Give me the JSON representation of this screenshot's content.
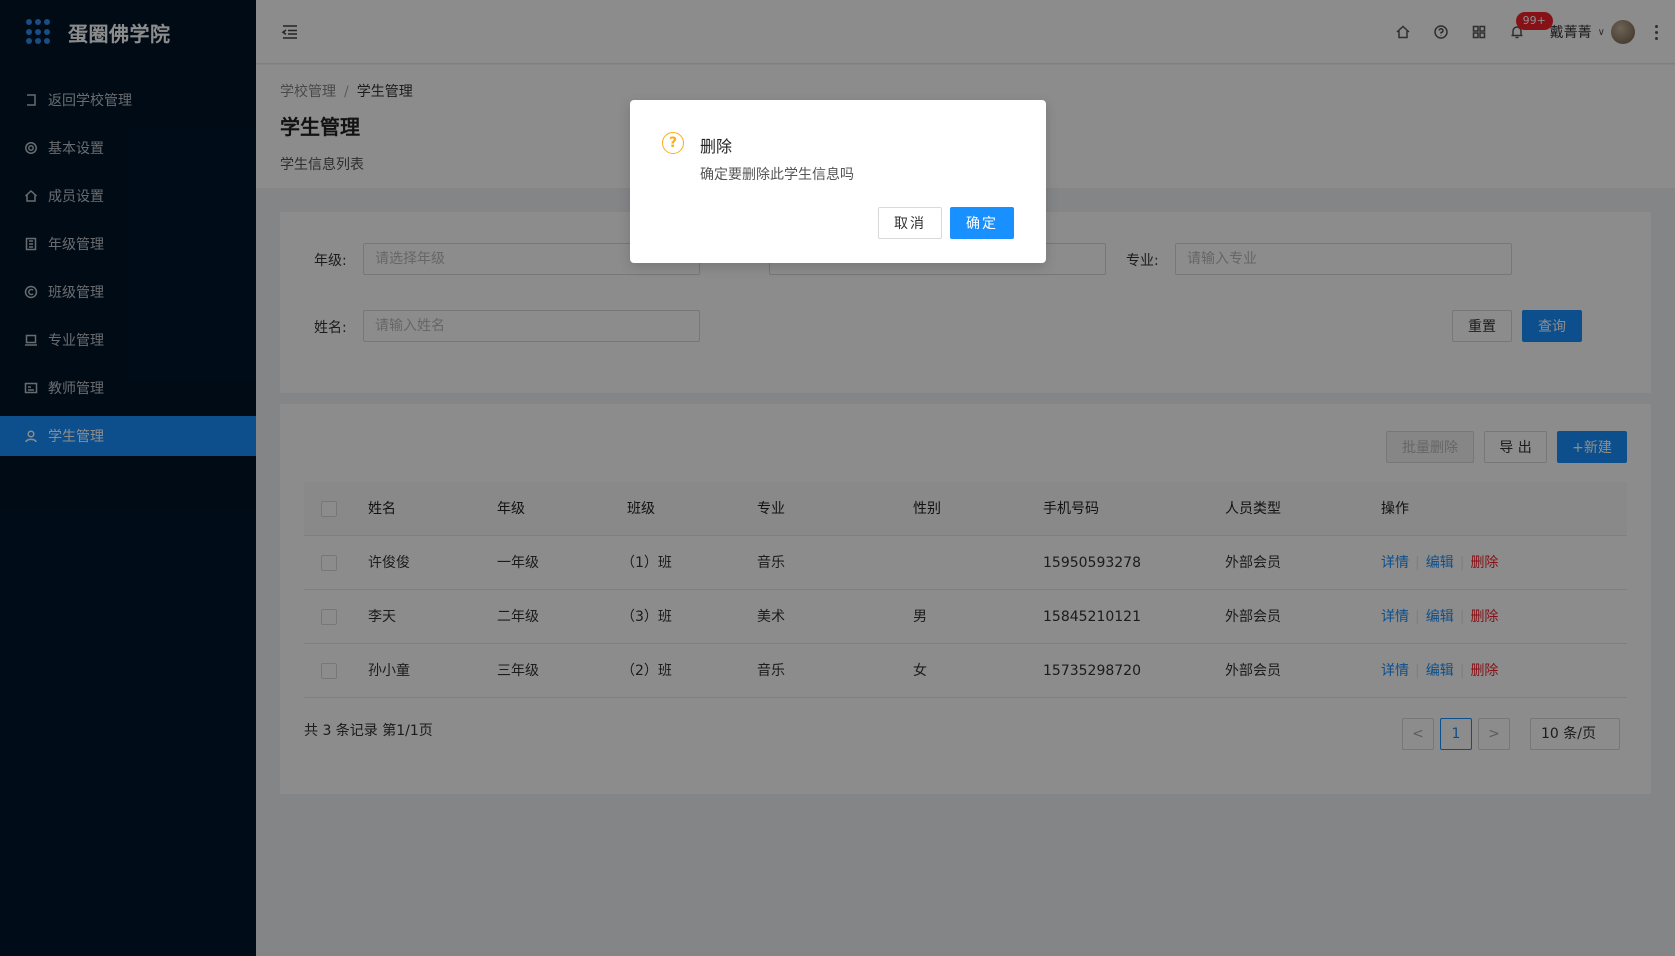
{
  "app": {
    "title": "蛋圈佛学院"
  },
  "sidebar": {
    "items": [
      {
        "label": "返回学校管理",
        "icon": "back-icon"
      },
      {
        "label": "基本设置",
        "icon": "gear-icon"
      },
      {
        "label": "成员设置",
        "icon": "home-icon"
      },
      {
        "label": "年级管理",
        "icon": "building-icon"
      },
      {
        "label": "班级管理",
        "icon": "copyright-icon"
      },
      {
        "label": "专业管理",
        "icon": "laptop-icon"
      },
      {
        "label": "教师管理",
        "icon": "idcard-icon"
      },
      {
        "label": "学生管理",
        "icon": "user-icon",
        "active": true
      }
    ]
  },
  "header": {
    "badge": "99+",
    "user_name": "戴菁菁",
    "caret": "∨"
  },
  "page": {
    "breadcrumb": [
      "学校管理",
      "学生管理"
    ],
    "breadcrumb_sep": "/",
    "title": "学生管理",
    "description": "学生信息列表"
  },
  "filters": {
    "grade_label": "年级:",
    "grade_placeholder": "请选择年级",
    "major_label": "专业:",
    "major_placeholder": "请输入专业",
    "name_label": "姓名:",
    "name_placeholder": "请输入姓名",
    "reset_label": "重置",
    "search_label": "查询"
  },
  "toolbar": {
    "batch_delete_label": "批量删除",
    "export_label": "导 出",
    "new_label": "+新建"
  },
  "table": {
    "columns": [
      "姓名",
      "年级",
      "班级",
      "专业",
      "性别",
      "手机号码",
      "人员类型",
      "操作"
    ],
    "rows": [
      {
        "name": "许俊俊",
        "grade": "一年级",
        "class": "（1）班",
        "major": "音乐",
        "gender": "",
        "phone": "15950593278",
        "type": "外部会员"
      },
      {
        "name": "李天",
        "grade": "二年级",
        "class": "（3）班",
        "major": "美术",
        "gender": "男",
        "phone": "15845210121",
        "type": "外部会员"
      },
      {
        "name": "孙小童",
        "grade": "三年级",
        "class": "（2）班",
        "major": "音乐",
        "gender": "女",
        "phone": "15735298720",
        "type": "外部会员"
      }
    ],
    "actions": {
      "detail": "详情",
      "edit": "编辑",
      "delete": "删除",
      "sep": "|"
    }
  },
  "pagination": {
    "summary": "共 3 条记录 第1/1页",
    "prev": "<",
    "current": "1",
    "next": ">",
    "page_size": "10 条/页"
  },
  "modal": {
    "icon": "question-icon",
    "icon_glyph": "?",
    "title": "删除",
    "content": "确定要删除此学生信息吗",
    "cancel_label": "取消",
    "ok_label": "确定"
  },
  "colors": {
    "sidebar_bg": "#001529",
    "primary": "#1890ff",
    "danger": "#f5222d",
    "warning": "#faad14"
  }
}
